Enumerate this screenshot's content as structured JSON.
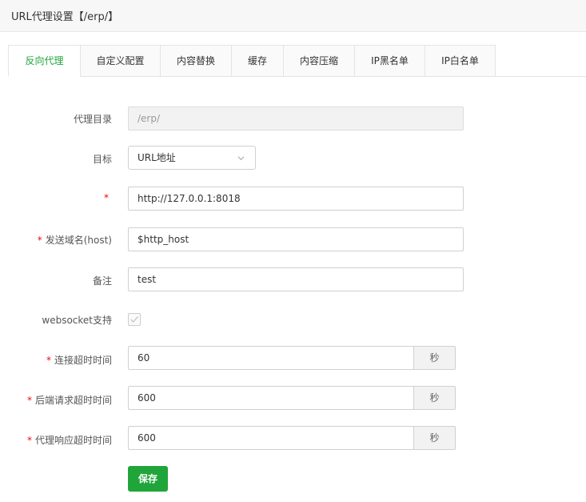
{
  "header": {
    "title": "URL代理设置【/erp/】"
  },
  "tabs": [
    {
      "label": "反向代理",
      "active": true
    },
    {
      "label": "自定义配置"
    },
    {
      "label": "内容替换"
    },
    {
      "label": "缓存"
    },
    {
      "label": "内容压缩"
    },
    {
      "label": "IP黑名单"
    },
    {
      "label": "IP白名单"
    }
  ],
  "form": {
    "proxy_dir": {
      "label": "代理目录",
      "value": "/erp/"
    },
    "target": {
      "label": "目标",
      "value": "URL地址"
    },
    "url": {
      "required_mark": "*",
      "value": "http://127.0.0.1:8018"
    },
    "host": {
      "required_mark": "*",
      "label": "发送域名(host)",
      "value": "$http_host"
    },
    "remark": {
      "label": "备注",
      "value": "test"
    },
    "websocket": {
      "label": "websocket支持",
      "checked": true
    },
    "connect_timeout": {
      "required_mark": "*",
      "label": "连接超时时间",
      "value": "60",
      "unit": "秒"
    },
    "backend_timeout": {
      "required_mark": "*",
      "label": "后端请求超时时间",
      "value": "600",
      "unit": "秒"
    },
    "response_timeout": {
      "required_mark": "*",
      "label": "代理响应超时时间",
      "value": "600",
      "unit": "秒"
    },
    "save_label": "保存"
  },
  "colors": {
    "accent": "#20a53a",
    "required": "#ef0808"
  },
  "icons": {
    "select_arrow": "chevron-down-icon",
    "checkbox_mark": "check-icon"
  }
}
